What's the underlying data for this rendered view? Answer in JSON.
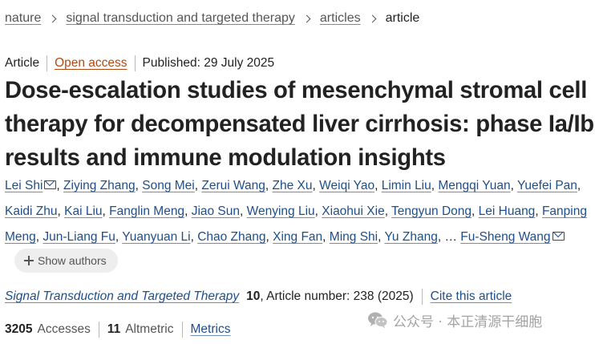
{
  "breadcrumb": {
    "items": [
      "nature",
      "signal transduction and targeted therapy",
      "articles"
    ],
    "current": "article"
  },
  "meta": {
    "type": "Article",
    "access": "Open access",
    "published": "Published: 29 July 2025"
  },
  "title": "Dose-escalation studies of mesenchymal stromal cell therapy for decompensated liver cirrhosis: phase Ia/Ib results and immune modulation insights",
  "authors": {
    "list": [
      "Lei Shi",
      "Ziying Zhang",
      "Song Mei",
      "Zerui Wang",
      "Zhe Xu",
      "Weiqi Yao",
      "Limin Liu",
      "Mengqi Yuan",
      "Yuefei Pan",
      "Kaidi Zhu",
      "Kai Liu",
      "Fanglin Meng",
      "Jiao Sun",
      "Wenying Liu",
      "Xiaohui Xie",
      "Tengyun Dong",
      "Lei Huang",
      "Fanping Meng",
      "Jun-Liang Fu",
      "Yuanyuan Li",
      "Chao Zhang",
      "Xing Fan",
      "Ming Shi",
      "Yu Zhang"
    ],
    "ellipsis": "…",
    "last": "Fu-Sheng Wang",
    "show_authors_label": "Show authors"
  },
  "journal": {
    "name": "Signal Transduction and Targeted Therapy",
    "volume": "10",
    "article_info": ", Article number: 238 (2025)",
    "cite_label": "Cite this article"
  },
  "metrics": {
    "accesses_count": "3205",
    "accesses_label": "Accesses",
    "altmetric_count": "11",
    "altmetric_label": "Altmetric",
    "metrics_label": "Metrics"
  },
  "watermark": {
    "text": "公众号 · 本正清源干细胞",
    "icon": "wechat-icon"
  },
  "colors": {
    "link": "#1f4f8b",
    "open_access": "#b24a15",
    "text": "#222222",
    "muted": "#555555"
  }
}
